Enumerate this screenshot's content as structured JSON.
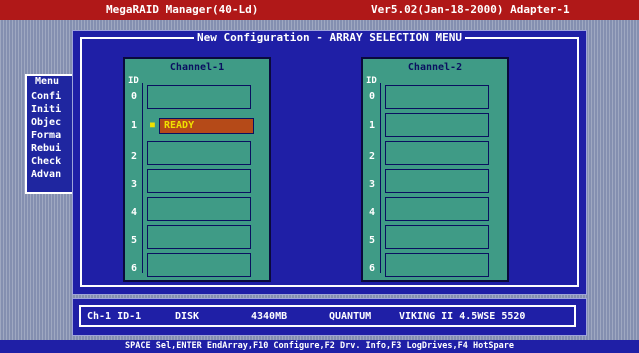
{
  "title_bar": {
    "app": "MegaRAID Manager(40-Ld)",
    "version": "Ver5.02(Jan-18-2000) Adapter-1"
  },
  "main_menu": {
    "title": "Menu",
    "items": [
      "Confi",
      "Initi",
      "Objec",
      "Forma",
      "Rebui",
      "Check",
      "Advan"
    ]
  },
  "dialog": {
    "title": "New Configuration - ARRAY SELECTION MENU"
  },
  "channels": [
    {
      "label": "Channel-1",
      "id_label": "ID",
      "slots": [
        {
          "id": "0",
          "state": ""
        },
        {
          "id": "1",
          "state": "READY"
        },
        {
          "id": "2",
          "state": ""
        },
        {
          "id": "3",
          "state": ""
        },
        {
          "id": "4",
          "state": ""
        },
        {
          "id": "5",
          "state": ""
        },
        {
          "id": "6",
          "state": ""
        }
      ]
    },
    {
      "label": "Channel-2",
      "id_label": "ID",
      "slots": [
        {
          "id": "0",
          "state": ""
        },
        {
          "id": "1",
          "state": ""
        },
        {
          "id": "2",
          "state": ""
        },
        {
          "id": "3",
          "state": ""
        },
        {
          "id": "4",
          "state": ""
        },
        {
          "id": "5",
          "state": ""
        },
        {
          "id": "6",
          "state": ""
        }
      ]
    }
  ],
  "status_line": {
    "location": "Ch-1 ID-1",
    "type": "DISK",
    "size": "4340MB",
    "vendor": "QUANTUM",
    "model": "VIKING II 4.5WSE 5520"
  },
  "help_bar": "SPACE Sel,ENTER EndArray,F10 Configure,F2 Drv. Info,F3 LogDrives,F4 HotSpare",
  "colors": {
    "title_bar": "#b01818",
    "dialog_bg": "#1f1fa6",
    "channel_bg": "#3f9b86",
    "selected_slot": "#b54a18",
    "highlight_text": "#f0e000"
  }
}
